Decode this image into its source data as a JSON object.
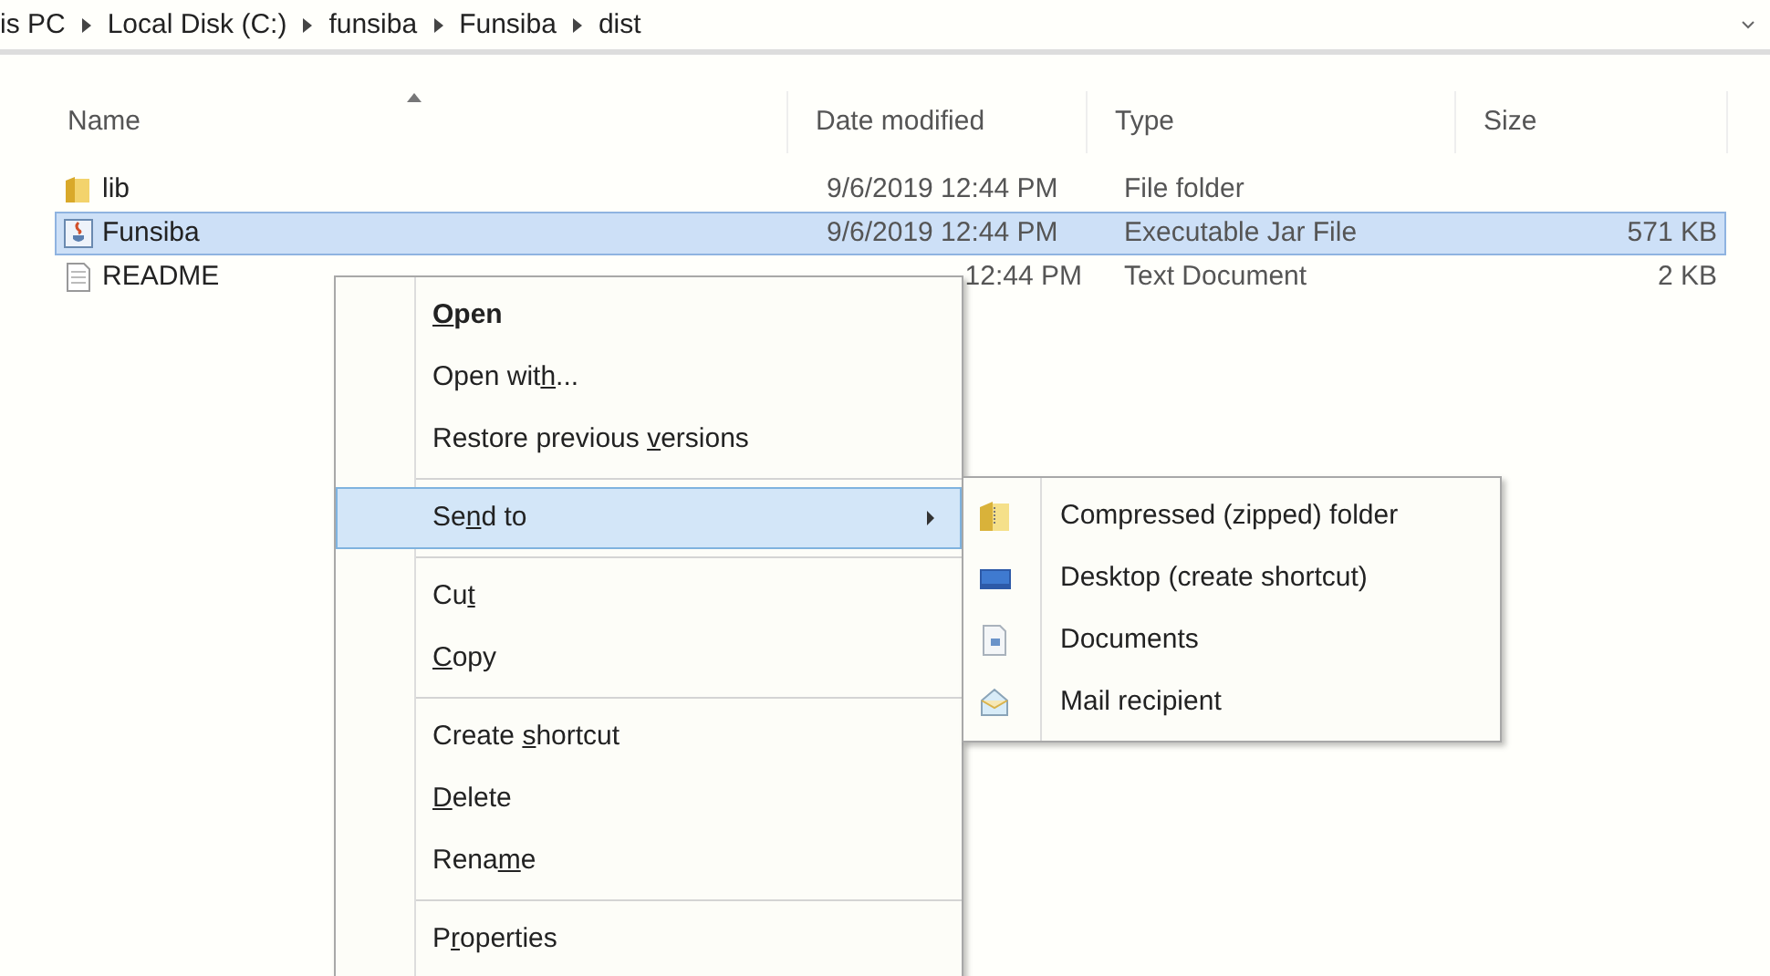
{
  "breadcrumb": [
    "is PC",
    "Local Disk (C:)",
    "funsiba",
    "Funsiba",
    "dist"
  ],
  "columns": [
    {
      "label": "Name",
      "sorted": true
    },
    {
      "label": "Date modified",
      "sorted": false
    },
    {
      "label": "Type",
      "sorted": false
    },
    {
      "label": "Size",
      "sorted": false
    }
  ],
  "files": [
    {
      "kind": "folder",
      "name": "lib",
      "date": "9/6/2019 12:44 PM",
      "type": "File folder",
      "selected": false
    },
    {
      "kind": "jar",
      "name": "Funsiba",
      "date": "9/6/2019 12:44 PM",
      "type": "Executable Jar File",
      "size": "571 KB",
      "selected": true
    },
    {
      "kind": "text",
      "name": "README",
      "date": "12:44 PM",
      "type": "Text Document",
      "size": "2 KB",
      "selected": false
    }
  ],
  "context_menu": [
    {
      "kind": "item",
      "key": "O",
      "post": "pen",
      "bold": true,
      "selected": false
    },
    {
      "kind": "item",
      "pre": "Open wit",
      "key": "h",
      "post": "...",
      "bold": false,
      "selected": false
    },
    {
      "kind": "item",
      "pre": "Restore previous ",
      "key": "v",
      "post": "ersions",
      "bold": false,
      "selected": false
    },
    {
      "kind": "separator"
    },
    {
      "kind": "submenu",
      "pre": "Se",
      "key": "n",
      "post": "d to",
      "bold": false,
      "selected": true
    },
    {
      "kind": "separator"
    },
    {
      "kind": "item",
      "pre": "Cu",
      "key": "t",
      "bold": false,
      "selected": false
    },
    {
      "kind": "item",
      "key": "C",
      "post": "opy",
      "bold": false,
      "selected": false
    },
    {
      "kind": "separator"
    },
    {
      "kind": "item",
      "pre": "Create ",
      "key": "s",
      "post": "hortcut",
      "bold": false,
      "selected": false
    },
    {
      "kind": "item",
      "key": "D",
      "post": "elete",
      "bold": false,
      "selected": false
    },
    {
      "kind": "item",
      "pre": "Rena",
      "key": "m",
      "post": "e",
      "bold": false,
      "selected": false
    },
    {
      "kind": "separator"
    },
    {
      "kind": "item",
      "pre": "P",
      "key": "r",
      "post": "operties",
      "bold": false,
      "selected": false
    }
  ],
  "send_to_menu": [
    {
      "kind": "zip",
      "label": "Compressed (zipped) folder"
    },
    {
      "kind": "desktop",
      "label": "Desktop (create shortcut)"
    },
    {
      "kind": "documents",
      "label": "Documents"
    },
    {
      "kind": "mail",
      "label": "Mail recipient"
    }
  ]
}
